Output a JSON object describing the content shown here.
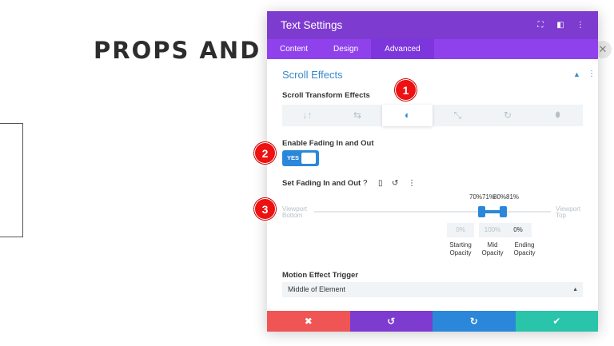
{
  "background": {
    "heading": "PROPS AND "
  },
  "modal": {
    "title": "Text Settings",
    "header_icons": [
      "expand-icon",
      "split-view-icon",
      "more-vertical-icon"
    ],
    "tabs": [
      {
        "label": "Content",
        "active": false
      },
      {
        "label": "Design",
        "active": false
      },
      {
        "label": "Advanced",
        "active": true
      }
    ],
    "section": {
      "title": "Scroll Effects",
      "transform_label": "Scroll Transform Effects",
      "effects": [
        {
          "icon": "vertical-motion-icon",
          "glyph": "↓↑",
          "active": false
        },
        {
          "icon": "horizontal-motion-icon",
          "glyph": "⇆",
          "active": false
        },
        {
          "icon": "fading-icon",
          "glyph": "◐",
          "active": true
        },
        {
          "icon": "scaling-icon",
          "glyph": "⤡",
          "active": false
        },
        {
          "icon": "rotating-icon",
          "glyph": "↻",
          "active": false
        },
        {
          "icon": "blur-icon",
          "glyph": "💧",
          "active": false
        }
      ],
      "fade_label": "Enable Fading In and Out",
      "toggle_value": "YES",
      "set_label": "Set Fading In and Out",
      "range": {
        "start_label": "Viewport\nBottom",
        "end_label": "Viewport\nTop",
        "percent_labels": [
          "70%",
          "71%",
          "80%",
          "81%"
        ]
      },
      "opacity": [
        {
          "value": "0%",
          "label": "Starting\nOpacity",
          "active": false
        },
        {
          "value": "100%",
          "label": "Mid\nOpacity",
          "active": false
        },
        {
          "value": "0%",
          "label": "Ending\nOpacity",
          "active": true
        }
      ],
      "trigger_label": "Motion Effect Trigger",
      "trigger_value": "Middle of Element"
    },
    "footer": [
      {
        "name": "discard-button",
        "glyph": "✖",
        "color": "#ef5555"
      },
      {
        "name": "undo-button",
        "glyph": "↺",
        "color": "#7e3bd0"
      },
      {
        "name": "redo-button",
        "glyph": "↻",
        "color": "#2b87da"
      },
      {
        "name": "save-button",
        "glyph": "✔",
        "color": "#29c4a9"
      }
    ]
  },
  "badges": [
    "1",
    "2",
    "3"
  ],
  "colors": {
    "header": "#7e3bd0",
    "tabs": "#8f42ec",
    "accent": "#2b87da",
    "badge": "#ee1111"
  }
}
